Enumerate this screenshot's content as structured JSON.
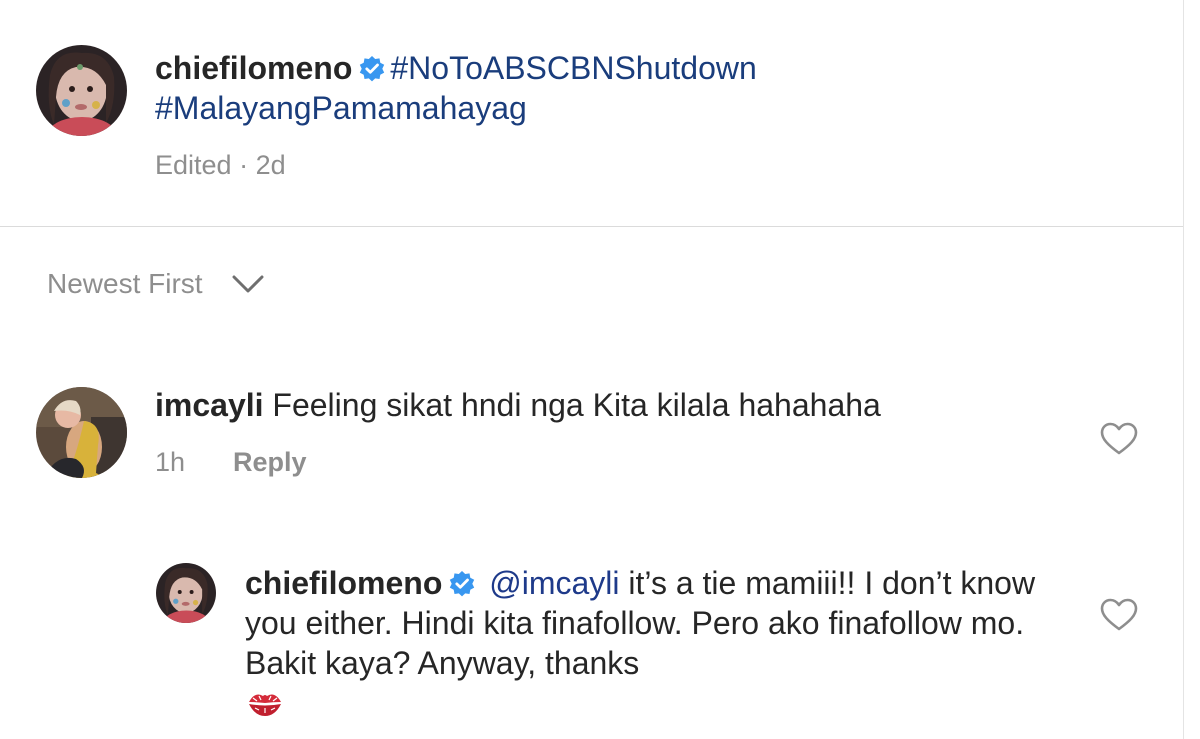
{
  "post": {
    "username": "chiefilomeno",
    "hashtag_1": "#NoToABSCBNShutdown",
    "hashtag_2": "#MalayangPamamahayag",
    "edited": "Edited",
    "separator": "·",
    "time": "2d"
  },
  "sort": {
    "label": "Newest First",
    "icon": "chevron-down-icon"
  },
  "comments": [
    {
      "username": "imcayli",
      "text": "Feeling sikat hndi nga Kita kilala hahahaha",
      "time": "1h",
      "reply_label": "Reply"
    },
    {
      "username": "chiefilomeno",
      "mention": "@imcayli",
      "text": "it’s a tie mamiii!! I don’t know you either. Hindi kita finafollow. Pero ako finafollow mo. Bakit kaya? Anyway, thanks",
      "emoji": "kiss-mark-icon"
    }
  ],
  "colors": {
    "hashtag": "#1a3d7c",
    "verified": "#3897f0",
    "meta_text": "#8e8e8e",
    "divider": "#dbdbdb"
  }
}
